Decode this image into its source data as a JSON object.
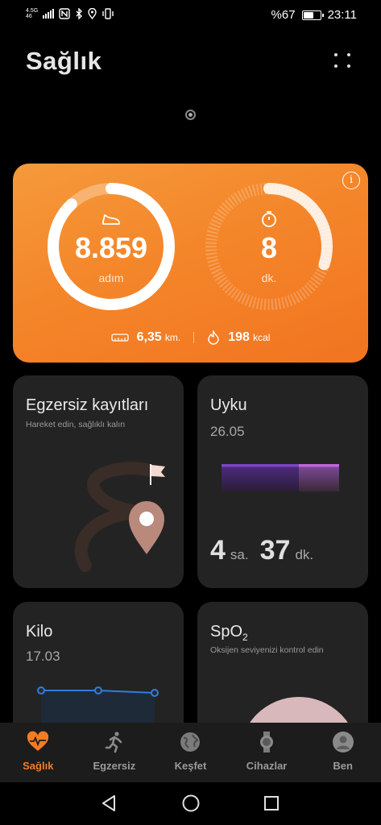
{
  "status_bar": {
    "network_top": "4.5G",
    "network_bottom": "46",
    "battery_text": "%67",
    "battery_level": 0.67,
    "time": "23:11"
  },
  "header": {
    "title": "Sağlık"
  },
  "activity": {
    "steps_value": "8.859",
    "steps_unit": "adım",
    "steps_progress": 0.88,
    "minutes_value": "8",
    "minutes_unit": "dk.",
    "minutes_progress": 0.3,
    "distance_value": "6,35",
    "distance_unit": "km.",
    "calories_value": "198",
    "calories_unit": "kcal",
    "accent": "#f4862a"
  },
  "workout_card": {
    "title": "Egzersiz kayıtları",
    "subtitle": "Hareket edin, sağlıklı kalın"
  },
  "sleep_card": {
    "title": "Uyku",
    "date": "26.05",
    "hours": "4",
    "hours_unit": "sa.",
    "minutes": "37",
    "minutes_unit": "dk."
  },
  "weight_card": {
    "title": "Kilo",
    "date": "17.03"
  },
  "spo2_card": {
    "title": "SpO",
    "title_sub": "2",
    "subtitle": "Oksijen seviyenizi kontrol edin"
  },
  "bottom_nav": {
    "items": [
      {
        "label": "Sağlık",
        "icon": "heart-pulse-icon",
        "active": true
      },
      {
        "label": "Egzersiz",
        "icon": "running-icon",
        "active": false
      },
      {
        "label": "Keşfet",
        "icon": "globe-icon",
        "active": false
      },
      {
        "label": "Cihazlar",
        "icon": "watch-icon",
        "active": false
      },
      {
        "label": "Ben",
        "icon": "profile-icon",
        "active": false
      }
    ],
    "active_color": "#f57c23"
  }
}
